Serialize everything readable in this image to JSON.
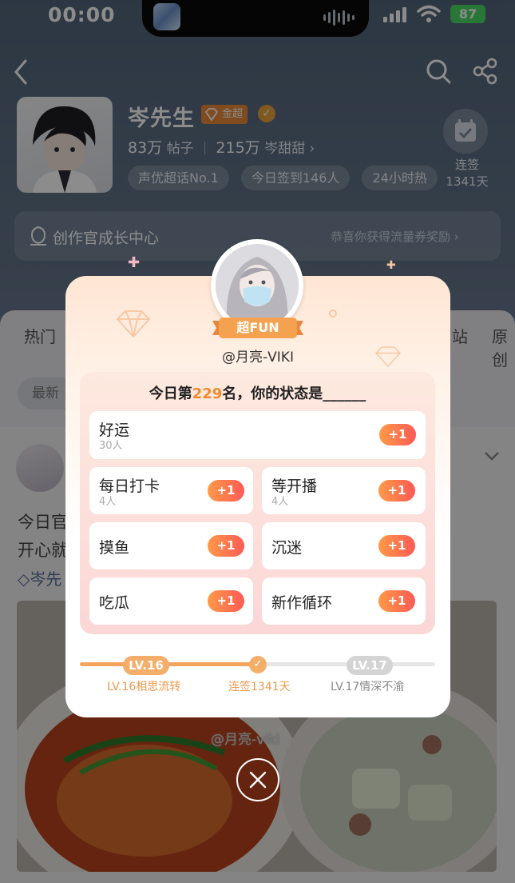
{
  "status_bar": {
    "time": "00:00",
    "battery": "87"
  },
  "profile": {
    "name": "岑先生",
    "badge": "金超",
    "posts_count": "83万",
    "posts_label": "帖子",
    "fans_count": "215万",
    "fans_label": "岑甜甜",
    "tags": [
      "声优超话No.1",
      "今日签到146人",
      "24小时热"
    ],
    "checkin_label": "连签",
    "checkin_days": "1341天"
  },
  "creator_center": {
    "title": "创作官成长中心",
    "hint": "恭喜你获得流量券奖励"
  },
  "tabs": {
    "left": "热门",
    "right1": "站",
    "right2": "原创"
  },
  "chip": {
    "label": "最新"
  },
  "post": {
    "line1": "今日官",
    "line2": "开心就",
    "link": "岑先",
    "watermark": "@月亮-viki"
  },
  "modal": {
    "fun_badge": "超FUN",
    "username": "@月亮-VIKI",
    "question_prefix": "今日第",
    "rank": "229",
    "question_suffix": "名，你的状态是______",
    "options": [
      {
        "label": "好运",
        "count": "30人",
        "action": "+1"
      },
      {
        "label": "每日打卡",
        "count": "4人",
        "action": "+1"
      },
      {
        "label": "等开播",
        "count": "4人",
        "action": "+1"
      },
      {
        "label": "摸鱼",
        "count": "",
        "action": "+1"
      },
      {
        "label": "沉迷",
        "count": "",
        "action": "+1"
      },
      {
        "label": "吃瓜",
        "count": "",
        "action": "+1"
      },
      {
        "label": "新作循环",
        "count": "",
        "action": "+1"
      }
    ],
    "level": {
      "current": "LV.16",
      "next": "LV.17",
      "current_name": "LV.16相思流转",
      "streak": "连签1341天",
      "next_name": "LV.17情深不渝",
      "progress": 0.5
    }
  },
  "colors": {
    "accent": "#f08a2c",
    "plus_start": "#ff9a48",
    "plus_end": "#ff5a55",
    "header_bg": "#5f7186"
  }
}
